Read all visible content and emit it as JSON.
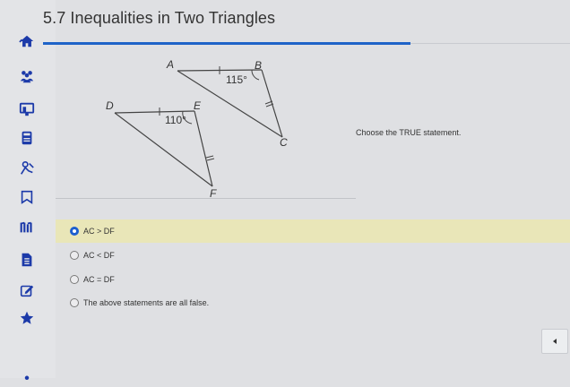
{
  "page": {
    "title": "5.7 Inequalities in Two Triangles"
  },
  "figure": {
    "labels": {
      "A": "A",
      "B": "B",
      "C": "C",
      "D": "D",
      "E": "E",
      "F": "F",
      "angle_b": "115°",
      "angle_e": "110°"
    }
  },
  "question": {
    "prompt": "Choose the TRUE statement."
  },
  "options": [
    {
      "label": "AC > DF",
      "selected": true
    },
    {
      "label": "AC < DF",
      "selected": false
    },
    {
      "label": "AC = DF",
      "selected": false
    },
    {
      "label": "The above statements are all false.",
      "selected": false
    }
  ],
  "sidebar": {
    "icons": [
      "home-icon",
      "group-icon",
      "screen-icon",
      "calculator-icon",
      "pen-hand-icon",
      "bookmark-icon",
      "bars-icon",
      "document-icon",
      "edit-icon",
      "star-icon"
    ]
  },
  "colors": {
    "accent": "#1e63c8",
    "selected_bg": "#e9e6b8",
    "sidebar_icon": "#1c3aa9"
  }
}
